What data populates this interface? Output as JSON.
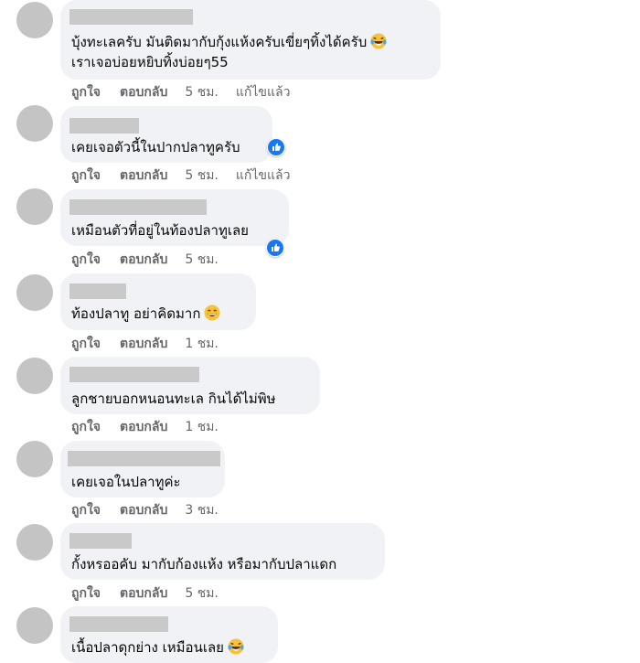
{
  "colors": {
    "bubble": "#f0f2f5",
    "avatar": "#c4c4c4",
    "meta": "#65676b",
    "like": "#1877f2"
  },
  "actions": {
    "like": "ถูกใจ",
    "reply": "ตอบกลับ",
    "edited": "แก้ไขแล้ว"
  },
  "comments": [
    {
      "lines": [
        "บุ้งทะเลครับ มันติดมากับกุ้งแห้งครับเขี่ยๆทิ้งได้ครับ",
        "เราเจอบ่อยหยิบทิ้งบ่อยๆ55"
      ],
      "emoji": "laughing-tears",
      "time": "5 ชม.",
      "edited": true
    },
    {
      "lines": [
        "เคยเจอตัวนี้ในปากปลาทูครับ"
      ],
      "reaction": "like",
      "time": "5 ชม.",
      "edited": true
    },
    {
      "lines": [
        "เหมือนตัวที่อยู่ในท้องปลาทูเลย"
      ],
      "reaction": "like",
      "time": "5 ชม."
    },
    {
      "lines": [
        "ท้องปลาทู อย่าคิดมาก"
      ],
      "emoji": "grin",
      "time": "1 ชม."
    },
    {
      "lines": [
        "ลูกชายบอกหนอนทะเล กินได้ไม่พิษ"
      ],
      "time": "1 ชม."
    },
    {
      "lines": [
        "เคยเจอในปลาทูค่ะ"
      ],
      "time": "3 ชม."
    },
    {
      "lines": [
        "กั้งหรออคับ มากับก้องแห้ง หรือมากับปลาแดก"
      ],
      "time": "5 ชม."
    },
    {
      "lines": [
        "เนื้อปลาดุกย่าง เหมือนเลย"
      ],
      "emoji": "laughing-tears"
    }
  ]
}
